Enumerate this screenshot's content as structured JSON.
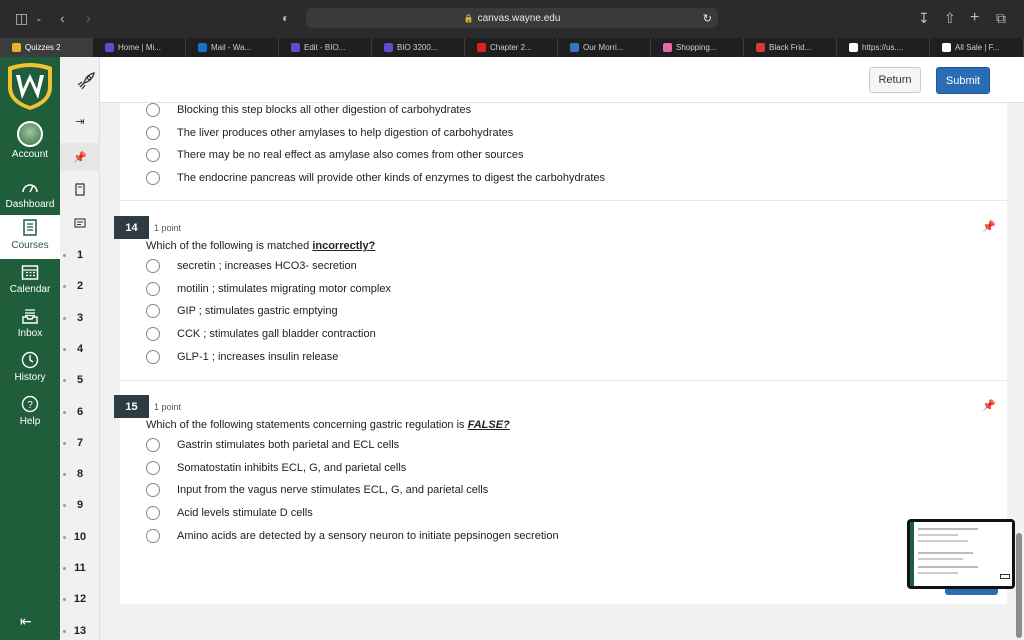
{
  "browser": {
    "url": "canvas.wayne.edu",
    "tabs": [
      {
        "label": "Quizzes 2",
        "active": true,
        "color": "#e8b423"
      },
      {
        "label": "Home | Mi...",
        "color": "#5b4fd0"
      },
      {
        "label": "Mail - Wa...",
        "color": "#1b6fd0"
      },
      {
        "label": "Edit - BIO...",
        "color": "#5b4fd0"
      },
      {
        "label": "BIO 3200...",
        "color": "#5b4fd0"
      },
      {
        "label": "Chapter 2...",
        "color": "#e02020"
      },
      {
        "label": "Our Morri...",
        "color": "#3a72c4"
      },
      {
        "label": "Shopping...",
        "color": "#e36ba8"
      },
      {
        "label": "Black Frid...",
        "color": "#d43b3b"
      },
      {
        "label": "https://us....",
        "color": "#ffffff"
      },
      {
        "label": "All Sale | F...",
        "color": "#ffffff"
      }
    ]
  },
  "global_nav": {
    "items": [
      {
        "label": "Account",
        "icon": "avatar"
      },
      {
        "label": "Dashboard",
        "icon": "gauge-icon"
      },
      {
        "label": "Courses",
        "icon": "book-icon",
        "active": true
      },
      {
        "label": "Calendar",
        "icon": "calendar-icon"
      },
      {
        "label": "Inbox",
        "icon": "inbox-icon"
      },
      {
        "label": "History",
        "icon": "clock-icon"
      },
      {
        "label": "Help",
        "icon": "help-icon"
      }
    ],
    "brand_color": "#205e3b"
  },
  "question_nav": {
    "numbers": [
      "1",
      "2",
      "3",
      "4",
      "5",
      "6",
      "7",
      "8",
      "9",
      "10",
      "11",
      "12",
      "13"
    ]
  },
  "header": {
    "return_label": "Return",
    "submit_label": "Submit"
  },
  "questions": [
    {
      "options": [
        "Blocking this step blocks all other digestion of carbohydrates",
        "The liver produces other amylases to help digestion of carbohydrates",
        "There may be no real effect as amylase also comes from other sources",
        "The endocrine pancreas will provide other kinds of enzymes to digest the carbohydrates"
      ]
    },
    {
      "number": "14",
      "points": "1 point",
      "text_before": "Which of the following is matched ",
      "text_emphasis": "incorrectly?",
      "options": [
        "secretin ; increases HCO3- secretion",
        "motilin ; stimulates migrating motor complex",
        "GIP ; stimulates gastric emptying",
        "CCK ; stimulates gall bladder contraction",
        "GLP-1 ; increases insulin release"
      ]
    },
    {
      "number": "15",
      "points": "1 point",
      "text_before": "Which of the following statements concerning gastric regulation is ",
      "text_emphasis": "FALSE?",
      "options": [
        "Gastrin stimulates both parietal and ECL cells",
        "Somatostatin inhibits ECL, G, and parietal cells",
        "Input from the vagus nerve stimulates ECL, G, and parietal cells",
        "Acid levels stimulate D cells",
        "Amino acids are detected by a sensory neuron to initiate pepsinogen secretion"
      ]
    }
  ]
}
